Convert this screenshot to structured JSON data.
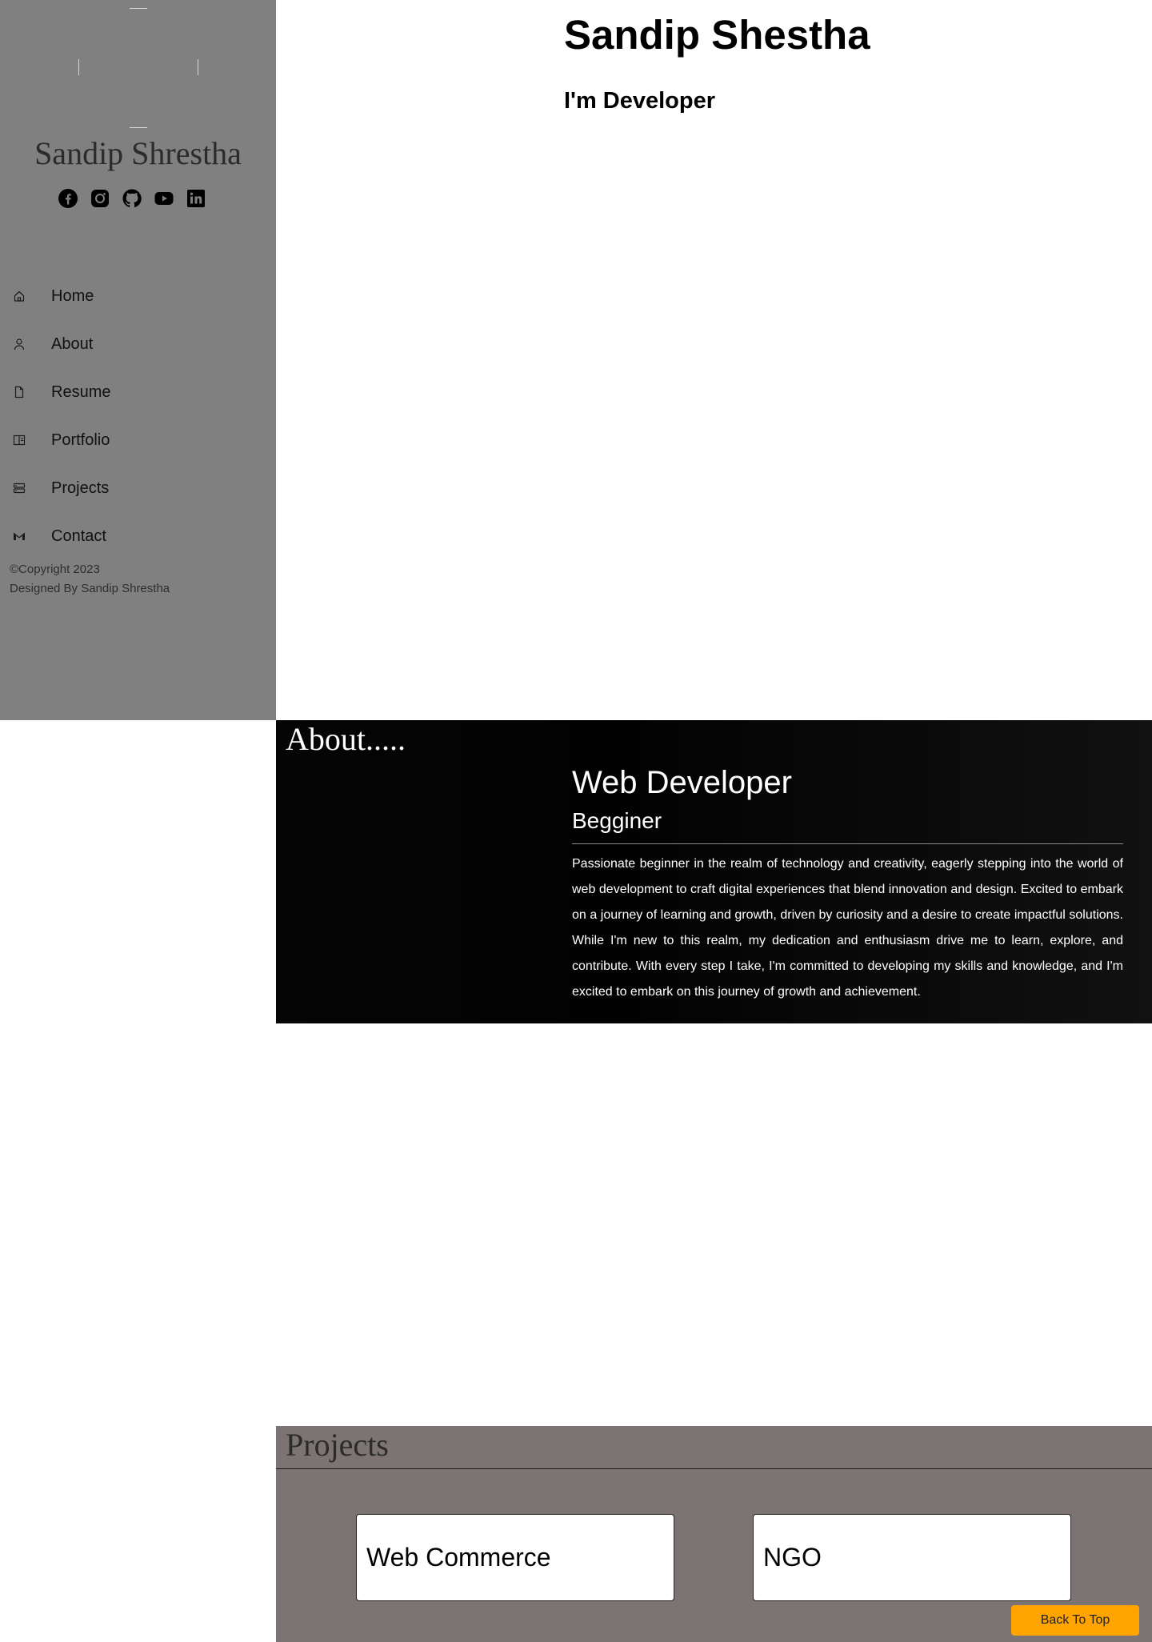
{
  "sidebar": {
    "name": "Sandip Shrestha",
    "social": [
      "facebook-icon",
      "instagram-icon",
      "github-icon",
      "youtube-icon",
      "linkedin-icon"
    ],
    "nav": [
      {
        "label": "Home",
        "icon": "home-icon"
      },
      {
        "label": "About",
        "icon": "person-icon"
      },
      {
        "label": "Resume",
        "icon": "file-icon"
      },
      {
        "label": "Portfolio",
        "icon": "book-icon"
      },
      {
        "label": "Projects",
        "icon": "server-icon"
      },
      {
        "label": "Contact",
        "icon": "mail-icon"
      }
    ],
    "copyright": "©Copyright 2023",
    "designed_by": "Designed By Sandip Shrestha"
  },
  "hero": {
    "name": "Sandip Shestha",
    "role": "I'm Developer"
  },
  "about": {
    "title": "About.....",
    "role": "Web Developer",
    "level": "Begginer",
    "text": "Passionate beginner in the realm of technology and creativity, eagerly stepping into the world of web development to craft digital experiences that blend innovation and design. Excited to embark on a journey of learning and growth, driven by curiosity and a desire to create impactful solutions. While I'm new to this realm, my dedication and enthusiasm drive me to learn, explore, and contribute. With every step I take, I'm committed to developing my skills and knowledge, and I'm excited to embark on this journey of growth and achievement."
  },
  "projects": {
    "title": "Projects",
    "cards": [
      "Web Commerce",
      "NGO"
    ]
  },
  "back_to_top": "Back To Top",
  "colors": {
    "sidebar_bg": "#808080",
    "about_bg": "#050505",
    "projects_bg": "#7b7473",
    "accent": "#ffa400"
  }
}
